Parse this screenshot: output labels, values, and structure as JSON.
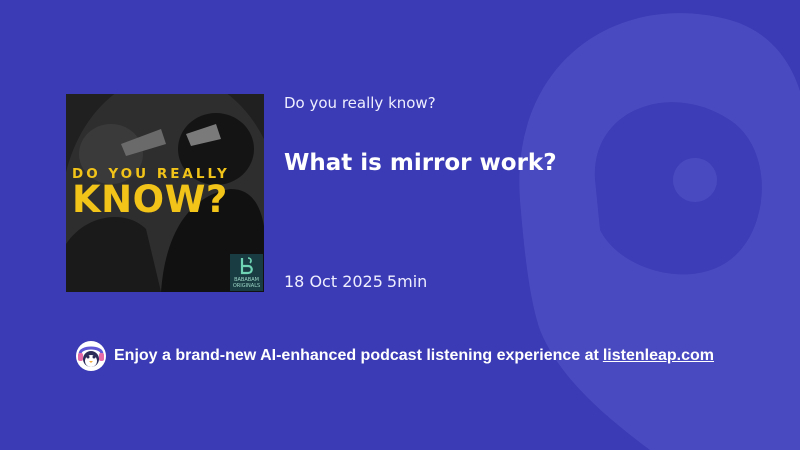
{
  "colors": {
    "background": "#3b3bb5",
    "accent_yellow": "#f2c318",
    "text": "#ffffff"
  },
  "background_logo": {
    "icon": "listenleap-logo-icon"
  },
  "podcast": {
    "cover": {
      "line1": "DO YOU REALLY",
      "line2": "KNOW?",
      "badge_icon": "bababam-logo-icon",
      "badge_text_1": "BABABAM",
      "badge_text_2": "ORIGINALS"
    },
    "show_name": "Do you really know?",
    "episode_title": "What is mirror work?",
    "date": "18 Oct 2025",
    "duration": "5min"
  },
  "promo": {
    "icon": "listenleap-mascot-icon",
    "text": "Enjoy a brand-new AI-enhanced podcast listening experience at",
    "link_text": "listenleap.com"
  }
}
